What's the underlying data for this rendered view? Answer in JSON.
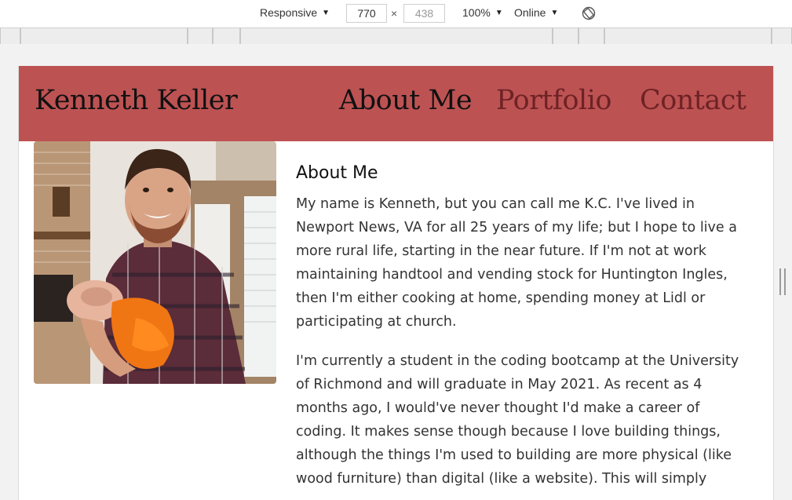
{
  "devtools": {
    "device": "Responsive",
    "width": "770",
    "height": "438",
    "times": "×",
    "zoom": "100%",
    "network": "Online"
  },
  "site": {
    "brand": "Kenneth Keller",
    "nav": {
      "about": "About Me",
      "portfolio": "Portfolio",
      "contact": "Contact"
    },
    "colors": {
      "navbar": "#bd5253",
      "nav_inactive": "#6e2225"
    }
  },
  "about": {
    "heading": "About Me",
    "para1_lines": [
      "My name is Kenneth, but you can call me K.C. I've lived in",
      "Newport News, VA for all 25 years of my life; but I hope to live a",
      "more rural life, starting in the near future. If I'm not at work",
      "maintaining handtool and vending stock for Huntington Ingles,",
      "then I'm either cooking at home, spending money at Lidl or",
      "participating at church."
    ],
    "para2_lines": [
      "I'm currently a student in the coding bootcamp at the University",
      "of Richmond and will graduate in May 2021. As recent as 4",
      "months ago, I would've never thought I'd make a career of",
      "coding. It makes sense though because I love building things,",
      "although the things I'm used to building are more physical (like",
      "wood furniture) than digital (like a website). This will simply"
    ]
  }
}
